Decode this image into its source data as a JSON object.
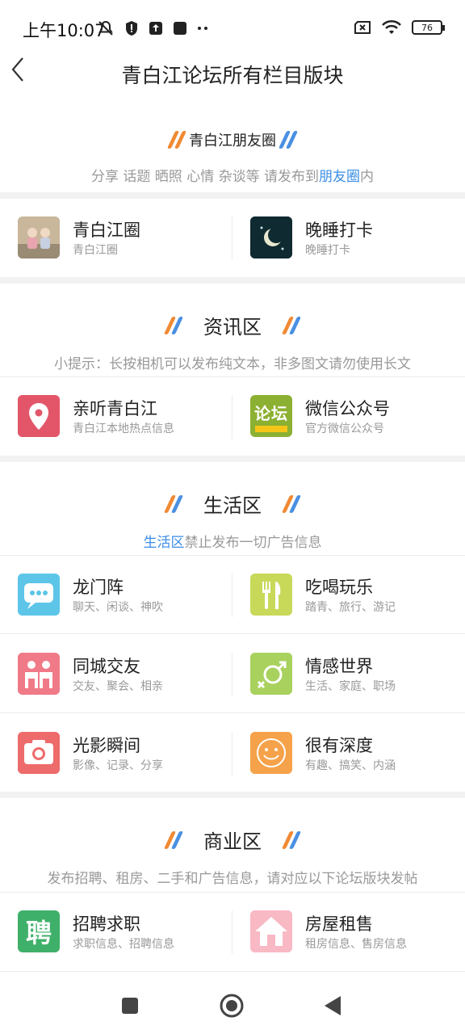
{
  "status_bar": {
    "time": "上午10:07",
    "battery": "76"
  },
  "header": {
    "title": "青白江论坛所有栏目版块"
  },
  "sections": [
    {
      "title": "青白江朋友圈",
      "subtitle_before": "分享 话题 晒照 心情 杂谈等 请发布到",
      "subtitle_highlight": "朋友圈",
      "subtitle_after": "内",
      "items": [
        {
          "name": "青白江圈",
          "desc": "青白江圈",
          "icon": "photo-icon"
        },
        {
          "name": "晚睡打卡",
          "desc": "晚睡打卡",
          "icon": "moon-icon"
        }
      ]
    },
    {
      "title": "资讯区",
      "subtitle": "小提示：长按相机可以发布纯文本，非多图文请勿使用长文",
      "items": [
        {
          "name": "亲听青白江",
          "desc": "青白江本地热点信息",
          "icon": "location-pin-icon"
        },
        {
          "name": "微信公众号",
          "desc": "官方微信公众号",
          "icon": "forum-badge-icon",
          "badge_text": "论坛"
        }
      ]
    },
    {
      "title": "生活区",
      "subtitle_highlight": "生活区",
      "subtitle_after": "禁止发布一切广告信息",
      "items": [
        {
          "name": "龙门阵",
          "desc": "聊天、闲谈、神吹",
          "icon": "chat-bubble-icon"
        },
        {
          "name": "吃喝玩乐",
          "desc": "踏青、旅行、游记",
          "icon": "cutlery-icon"
        },
        {
          "name": "同城交友",
          "desc": "交友、聚会、相亲",
          "icon": "people-icon"
        },
        {
          "name": "情感世界",
          "desc": "生活、家庭、职场",
          "icon": "gender-icon"
        },
        {
          "name": "光影瞬间",
          "desc": "影像、记录、分享",
          "icon": "camera-icon"
        },
        {
          "name": "很有深度",
          "desc": "有趣、搞笑、内涵",
          "icon": "smiley-icon"
        }
      ]
    },
    {
      "title": "商业区",
      "subtitle": "发布招聘、租房、二手和广告信息，请对应以下论坛版块发帖",
      "items": [
        {
          "name": "招聘求职",
          "desc": "求职信息、招聘信息",
          "icon": "recruit-icon",
          "badge_text": "聘"
        },
        {
          "name": "房屋租售",
          "desc": "租房信息、售房信息",
          "icon": "house-icon"
        }
      ]
    }
  ],
  "colors": {
    "accent_blue": "#3a8ee6",
    "slash_orange": "#f08a34",
    "slash_blue": "#4a90e2"
  }
}
